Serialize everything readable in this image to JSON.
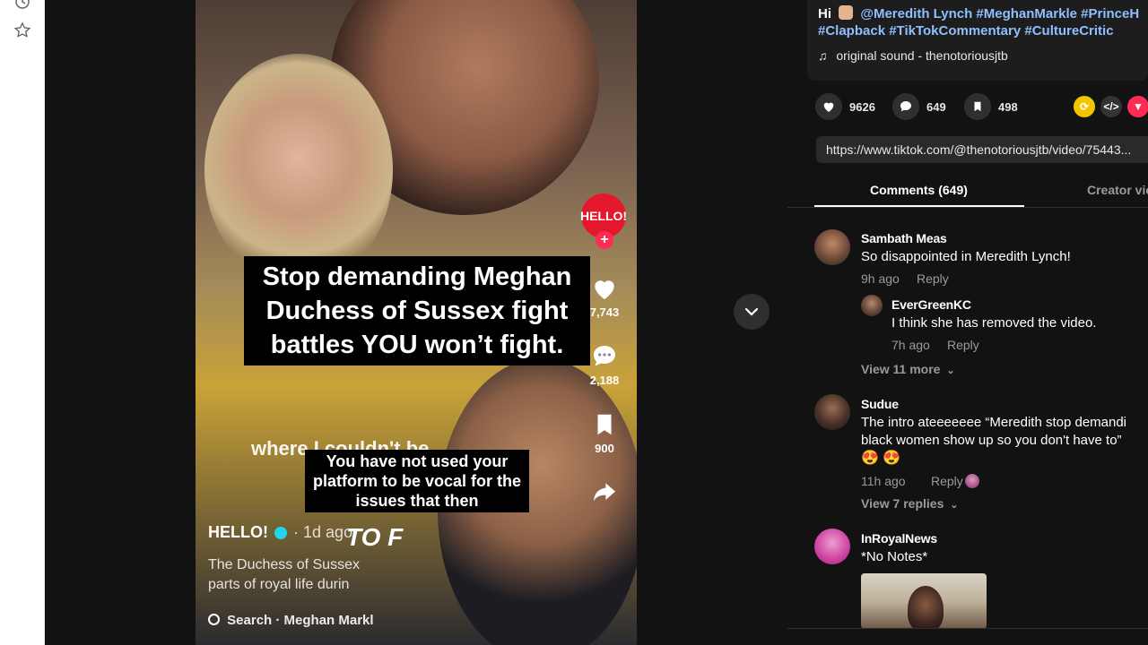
{
  "video": {
    "caption_main": "Stop demanding Meghan Duchess of Sussex fight battles YOU won’t fight.",
    "caption_sub": "You have not used your platform to be vocal for the issues that then",
    "ghost_text": "where I couldn't be",
    "to_text": "TO F",
    "author": "HELLO!",
    "post_age": "· 1d ago",
    "overlay_desc": "The Duchess of Sussex parts of royal life durin",
    "search_label": "Search · Meghan Markl",
    "hello_badge": "HELLO!",
    "plus": "+",
    "likes": "7,743",
    "comments": "2,188",
    "saves": "900"
  },
  "description": {
    "greeting": "Hi",
    "line1_tags": "@Meredith Lynch #MeghanMarkle #PrinceH",
    "line2_tags": "#Clapback #TikTokCommentary #CultureCritic",
    "music": "original sound - thenotoriousjtb"
  },
  "stats": {
    "likes": "9626",
    "comments": "649",
    "saves": "498"
  },
  "url": "https://www.tiktok.com/@thenotoriousjtb/video/75443...",
  "tabs": {
    "comments": "Comments (649)",
    "creator": "Creator vic"
  },
  "comments": [
    {
      "name": "Sambath Meas",
      "text": "So disappointed in Meredith Lynch!",
      "time": "9h ago",
      "reply": "Reply"
    },
    {
      "name": "EverGreenKC",
      "text": "I think she has removed the video.",
      "time": "7h ago",
      "reply": "Reply"
    },
    {
      "view_more": "View 11 more"
    },
    {
      "name": "Sudue",
      "text_line1": "The intro ateeeeeee “Meredith stop demandi",
      "text_line2": "black women show up so you don't have to”",
      "time": "11h ago",
      "reply": "Reply"
    },
    {
      "view_more": "View 7 replies"
    },
    {
      "name": "InRoyalNews",
      "text": "*No Notes*"
    }
  ],
  "colors": {
    "accent_pink": "#fe2c55",
    "link_blue": "#8fbfff",
    "panel_bg": "#121212"
  },
  "icons": {
    "history": "clock-icon",
    "favorites": "star-icon",
    "like": "heart-icon",
    "comment": "comment-bubble-icon",
    "save": "bookmark-icon",
    "share": "share-arrow-icon",
    "next": "chevron-down-icon",
    "music": "music-note-icon"
  }
}
